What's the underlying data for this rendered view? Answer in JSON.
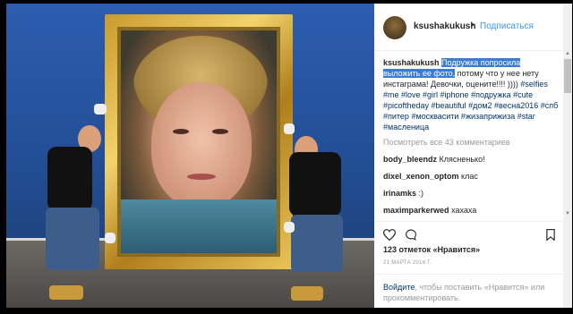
{
  "post": {
    "username": "ksushakukush",
    "dot": "•",
    "follow_label": "Подписаться"
  },
  "caption": {
    "username": "ksushakukush",
    "highlighted": "Подружка попросила выложить ее фото,",
    "text": " потому что у нее нету инстаграма! Девочки, оцените!!!! ))))",
    "hashtags": "#selfies #me #love #girl #iphone #подружка #cute #picoftheday #beautiful #дом2 #весна2016 #спб #питер #москвасити #жизаприжиза #star #масленица"
  },
  "comments": {
    "view_all": "Посмотреть все 43 комментариев",
    "items": [
      {
        "user": "body_bleendz",
        "text": "Клясненько!"
      },
      {
        "user": "dixel_xenon_optom",
        "text": "клас"
      },
      {
        "user": "irinamks",
        "text": ":)"
      },
      {
        "user": "maximparkerwed",
        "text": "хахаха"
      }
    ]
  },
  "stats": {
    "likes": "123 отметок «Нравится»",
    "date": "21 МАРТА 2016 Г."
  },
  "login_prompt": {
    "login_link": "Войдите",
    "text": ", чтобы поставить «Нравится» или прокомментировать."
  },
  "icons": {
    "heart": "heart-icon",
    "comment": "comment-icon",
    "bookmark": "bookmark-icon"
  }
}
